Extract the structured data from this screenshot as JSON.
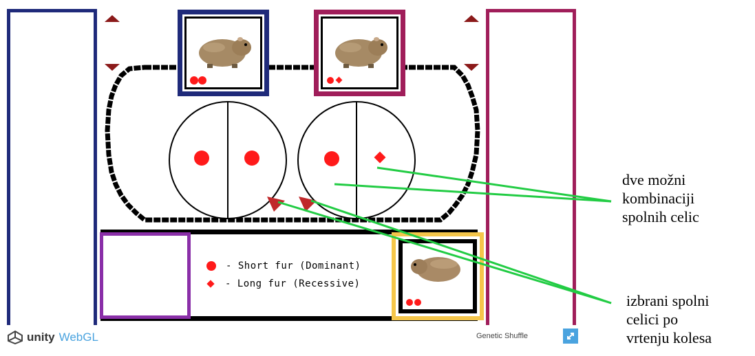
{
  "legend": {
    "dominant": "- Short fur (Dominant)",
    "recessive": "- Long fur (Recessive)"
  },
  "footer": {
    "brand_unity": "unity",
    "brand_webgl": "WebGL",
    "game_title": "Genetic Shuffle"
  },
  "annotations": {
    "combinations": [
      "dve možni",
      "kombinaciji",
      "spolnih celic"
    ],
    "selected": [
      "izbrani spolni",
      "celici po",
      "vrtenju kolesa"
    ]
  },
  "icons": {
    "dominant_marker": "red-circle",
    "recessive_marker": "red-diamond",
    "fullscreen": "fullscreen-icon",
    "selector": "red-triangle-pointer"
  },
  "colors": {
    "navy": "#1f2a7a",
    "magenta": "#a01e5a",
    "purple": "#8a2fa8",
    "yellow": "#f5c64a",
    "allele_red": "#ff1a1a",
    "arrow_red": "#8b1a1a",
    "annotation_green": "#22cc44",
    "webgl_blue": "#4aa3df"
  }
}
